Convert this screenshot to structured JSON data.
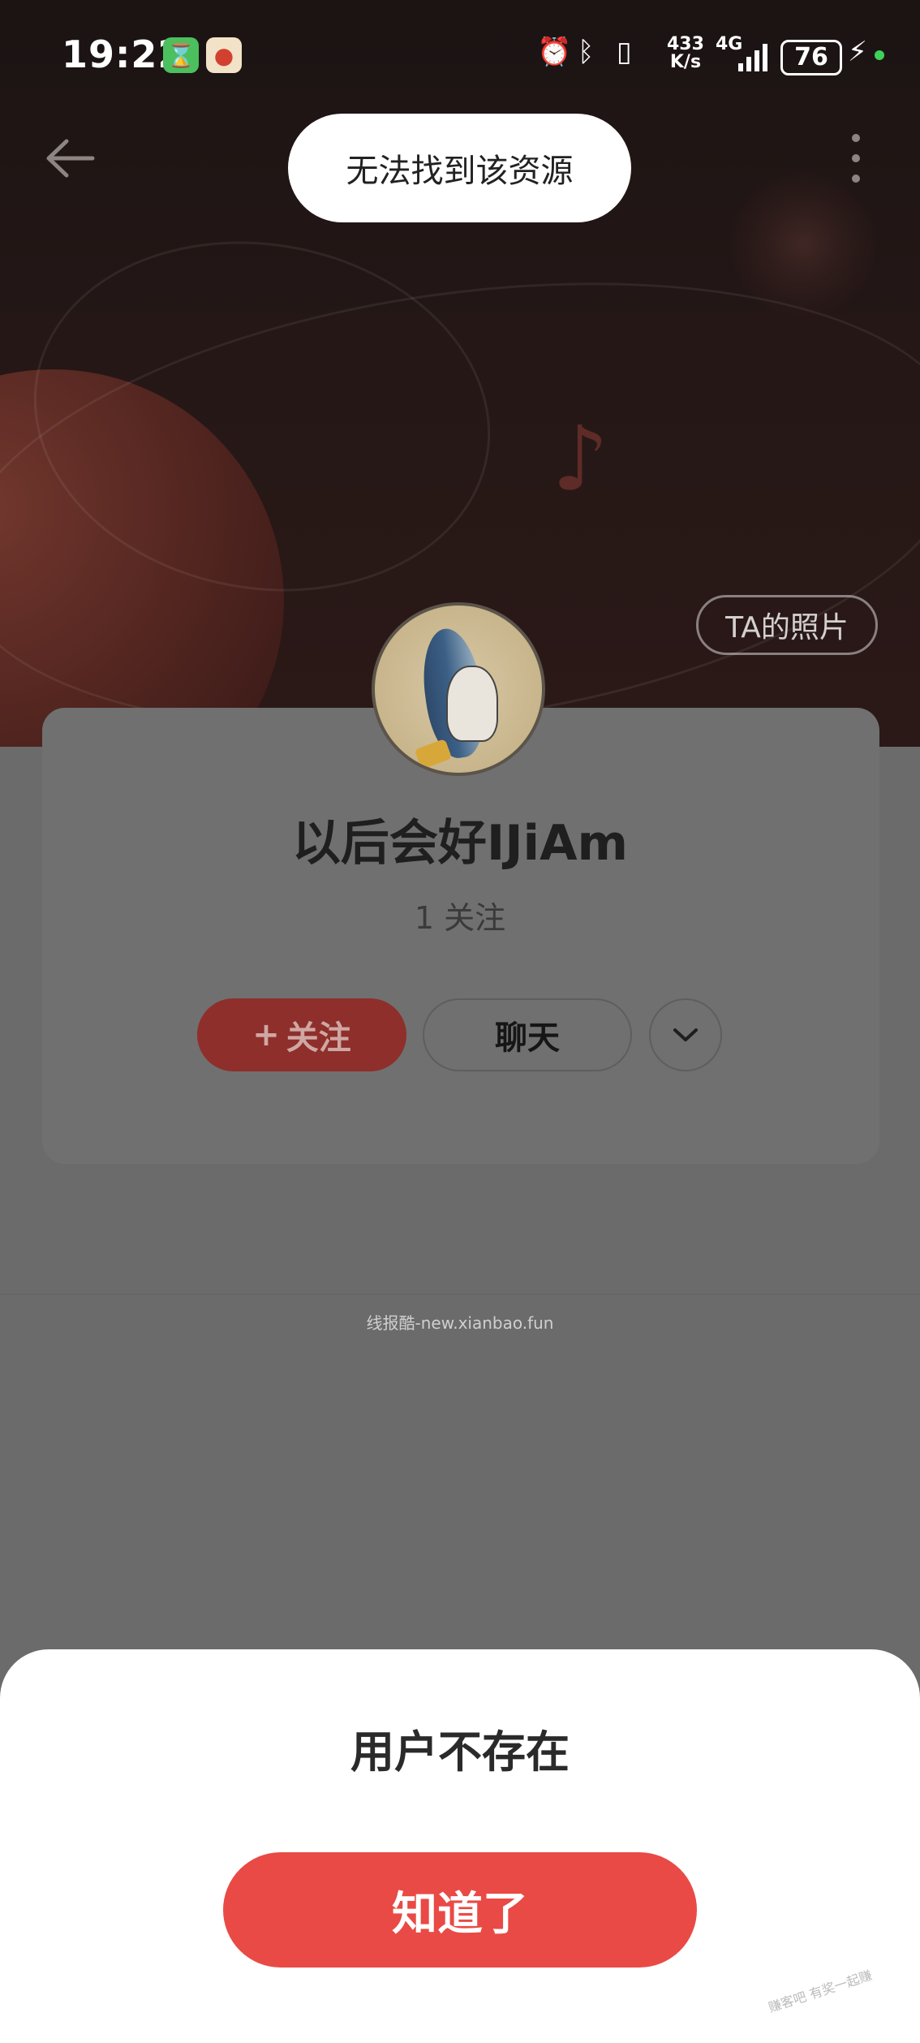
{
  "status_bar": {
    "time": "19:22",
    "net_speed_top": "433",
    "net_speed_unit": "K/s",
    "network_type": "4G",
    "battery": "76"
  },
  "toast": {
    "text": "无法找到该资源"
  },
  "header": {
    "photos_button": "TA的照片"
  },
  "profile": {
    "username": "以后会好IJiAm",
    "follows": "1 关注",
    "follow_button": "关注",
    "follow_plus": "+",
    "chat_button": "聊天"
  },
  "watermark": "线报酷-new.xianbao.fun",
  "sheet": {
    "title": "用户不存在",
    "confirm_button": "知道了"
  },
  "colors": {
    "accent": "#e94a45",
    "follow_dimmed": "#8e2f2b",
    "overlay": "#6b6b6b"
  }
}
